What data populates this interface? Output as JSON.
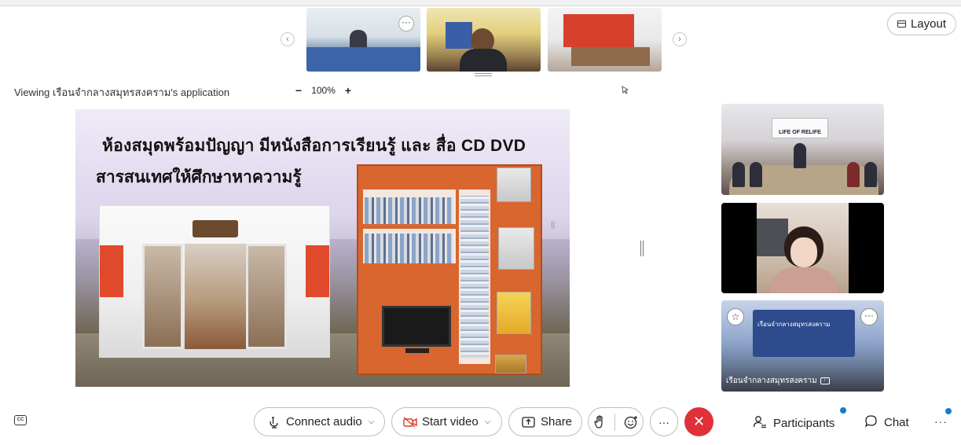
{
  "top_strip": {
    "prev_icon": "chevron-left-icon",
    "next_icon": "chevron-right-icon",
    "more_label": "···"
  },
  "layout_button": {
    "label": "Layout",
    "icon": "layout-icon"
  },
  "viewing_bar": {
    "text": "Viewing เรือนจำกลางสมุทรสงคราม's application",
    "zoom_out": "−",
    "zoom_level": "100%",
    "zoom_in": "+"
  },
  "slide": {
    "title_line1": "ห้องสมุดพร้อมปัญญา  มีหนังสือการเรียนรู้ และ สื่อ CD  DVD",
    "title_line2": "สารสนเทศให้ศึกษาหาความรู้"
  },
  "tiles": {
    "tile1_banner": "LIFE OF RELIFE",
    "tile3_stage_text": "เรือนจำกลางสมุทรสงคราม",
    "tile3_name": "เรือนจำกลางสมุทรสงคราม",
    "tile3_pin_label": "☆",
    "tile3_more_label": "···"
  },
  "controls": {
    "captions_icon": "CC",
    "connect_audio": "Connect audio",
    "start_video": "Start video",
    "share": "Share",
    "more": "···",
    "leave": "✕",
    "participants": "Participants",
    "chat": "Chat",
    "overflow": "···"
  },
  "colors": {
    "leave_red": "#e0313b",
    "notification_blue": "#1a7ad4",
    "video_icon_red": "#d93a2b"
  }
}
